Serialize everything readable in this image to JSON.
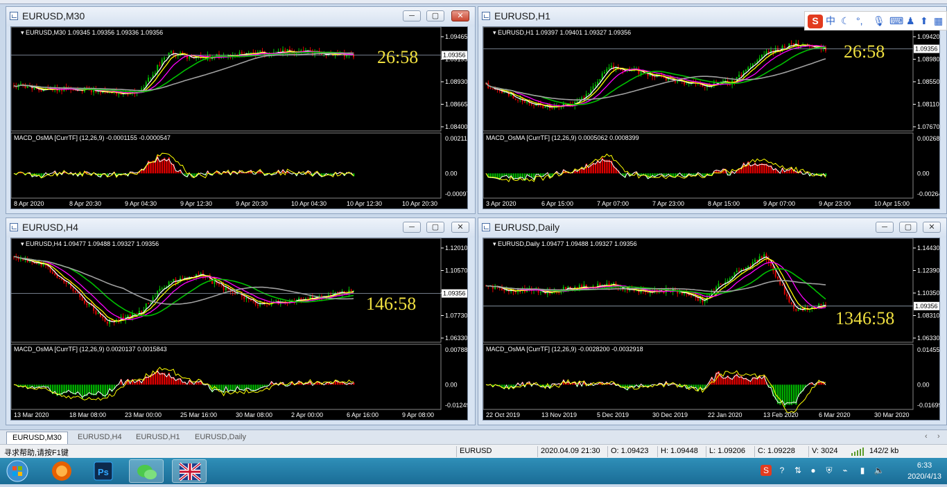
{
  "windows": [
    {
      "title": "EURUSD,M30",
      "info": "EURUSD,M30  1.09345 1.09356 1.09336 1.09356",
      "price_ticks": [
        "1.09465",
        "1.09195",
        "1.08930",
        "1.08665",
        "1.08400"
      ],
      "current_price": "1.09356",
      "timer": "26:58",
      "macd_label": "MACD_OsMA [CurrTF] (12,26,9) -0.0001155 -0.0000547",
      "macd_ticks": [
        "0.0021118",
        "0.00",
        "-0.000979"
      ],
      "time_ticks": [
        "8 Apr 2020",
        "8 Apr 20:30",
        "9 Apr 04:30",
        "9 Apr 12:30",
        "9 Apr 20:30",
        "10 Apr 04:30",
        "10 Apr 12:30",
        "10 Apr 20:30"
      ]
    },
    {
      "title": "EURUSD,H1",
      "info": "EURUSD,H1  1.09397 1.09401 1.09327 1.09356",
      "price_ticks": [
        "1.09420",
        "1.08980",
        "1.08550",
        "1.08110",
        "1.07670"
      ],
      "current_price": "1.09356",
      "timer": "26:58",
      "macd_label": "MACD_OsMA [CurrTF] (12,26,9) 0.0005062 0.0008399",
      "macd_ticks": [
        "0.0026812",
        "0.00",
        "-0.002647"
      ],
      "time_ticks": [
        "3 Apr 2020",
        "6 Apr 15:00",
        "7 Apr 07:00",
        "7 Apr 23:00",
        "8 Apr 15:00",
        "9 Apr 07:00",
        "9 Apr 23:00",
        "10 Apr 15:00"
      ]
    },
    {
      "title": "EURUSD,H4",
      "info": "EURUSD,H4  1.09477 1.09488 1.09327 1.09356",
      "price_ticks": [
        "1.12010",
        "1.10570",
        "1.09356",
        "1.07730",
        "1.06330"
      ],
      "current_price": "1.09356",
      "timer": "146:58",
      "macd_label": "MACD_OsMA [CurrTF] (12,26,9) 0.0020137 0.0015843",
      "macd_ticks": [
        "0.0078805",
        "0.00",
        "-0.012499"
      ],
      "time_ticks": [
        "13 Mar 2020",
        "18 Mar 08:00",
        "23 Mar 00:00",
        "25 Mar 16:00",
        "30 Mar 08:00",
        "2 Apr 00:00",
        "6 Apr 16:00",
        "9 Apr 08:00"
      ]
    },
    {
      "title": "EURUSD,Daily",
      "info": "EURUSD,Daily  1.09477 1.09488 1.09327 1.09356",
      "price_ticks": [
        "1.14430",
        "1.12390",
        "1.10350",
        "1.08310",
        "1.06330"
      ],
      "current_price": "1.09356",
      "timer": "1346:58",
      "macd_label": "MACD_OsMA [CurrTF] (12,26,9) -0.0028200 -0.0032918",
      "macd_ticks": [
        "0.0145509",
        "0.00",
        "-0.016995"
      ],
      "time_ticks": [
        "22 Oct 2019",
        "13 Nov 2019",
        "5 Dec 2019",
        "30 Dec 2019",
        "22 Jan 2020",
        "13 Feb 2020",
        "6 Mar 2020",
        "30 Mar 2020"
      ]
    }
  ],
  "tabs": [
    "EURUSD,M30",
    "EURUSD,H4",
    "EURUSD,H1",
    "EURUSD,Daily"
  ],
  "status": {
    "help": "寻求帮助,请按F1键",
    "symbol": "EURUSD",
    "datetime": "2020.04.09 21:30",
    "open": "O: 1.09423",
    "high": "H: 1.09448",
    "low": "L: 1.09206",
    "close": "C: 1.09228",
    "volume": "V: 3024",
    "traffic": "142/2 kb"
  },
  "ime": {
    "logo": "S",
    "lang": "中"
  },
  "clock": {
    "time": "6:33",
    "date": "2020/4/13"
  },
  "colors": {
    "bull": "#00c000",
    "bear": "#e00000",
    "hist_pos": "#e00000",
    "hist_neg": "#00b000",
    "timer": "#f0e040"
  }
}
